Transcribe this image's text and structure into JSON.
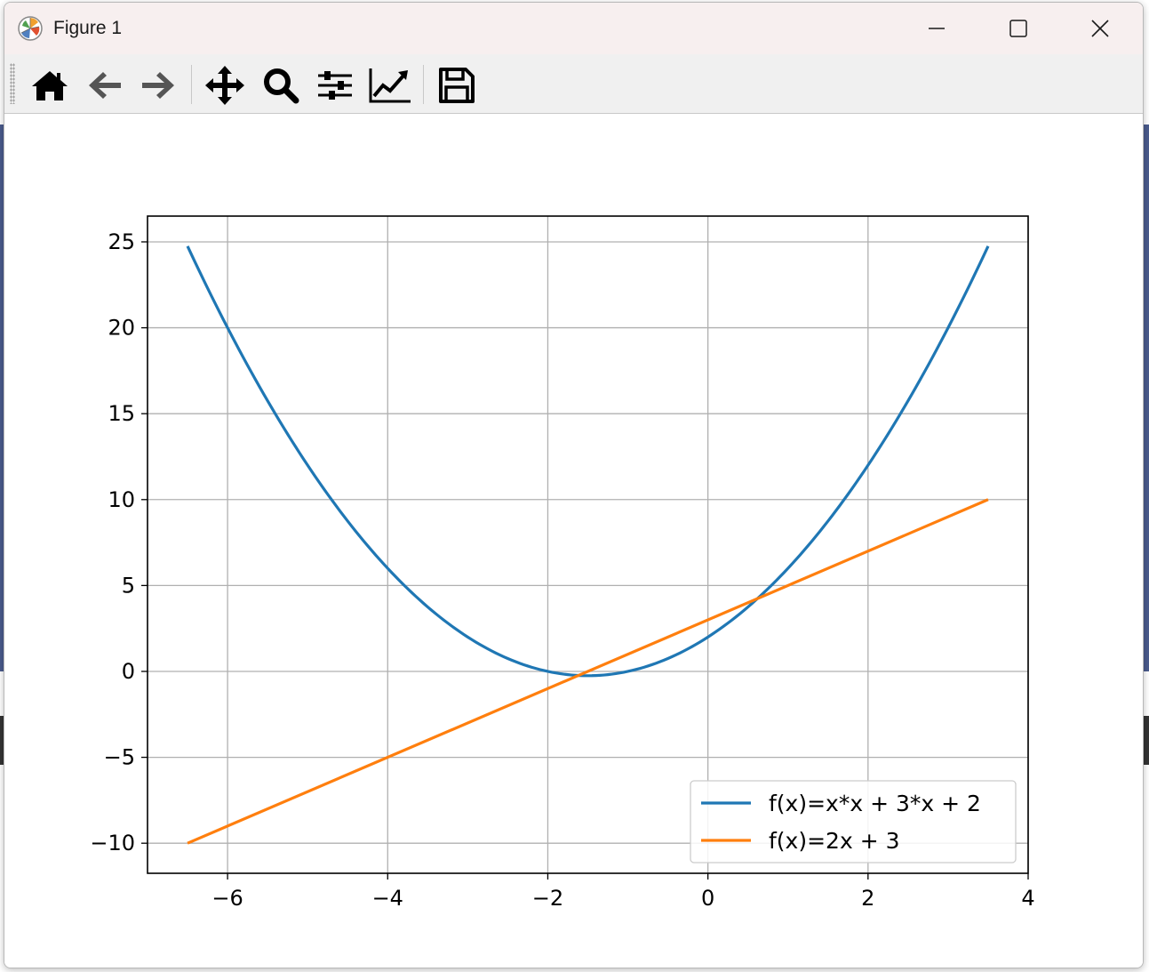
{
  "window": {
    "title": "Figure 1"
  },
  "toolbar": {
    "buttons": [
      {
        "name": "home-icon"
      },
      {
        "name": "back-arrow-icon"
      },
      {
        "name": "forward-arrow-icon"
      },
      {
        "name": "pan-icon"
      },
      {
        "name": "zoom-icon"
      },
      {
        "name": "configure-subplots-icon"
      },
      {
        "name": "edit-axis-icon"
      },
      {
        "name": "save-icon"
      }
    ]
  },
  "colors": {
    "series1": "#1f77b4",
    "series2": "#ff7f0e",
    "grid": "#b0b0b0",
    "titlebar": "#f7efef",
    "toolbar": "#f0f0f0"
  },
  "chart_data": {
    "type": "line",
    "title": "",
    "xlabel": "",
    "ylabel": "",
    "xlim": [
      -7,
      4
    ],
    "ylim": [
      -11.75,
      26.5
    ],
    "xticks": [
      -6,
      -4,
      -2,
      0,
      2,
      4
    ],
    "yticks": [
      -10,
      -5,
      0,
      5,
      10,
      15,
      20,
      25
    ],
    "xtick_labels": [
      "−6",
      "−4",
      "−2",
      "0",
      "2",
      "4"
    ],
    "ytick_labels": [
      "−10",
      "−5",
      "0",
      "5",
      "10",
      "15",
      "20",
      "25"
    ],
    "grid": true,
    "legend_position": "lower right",
    "series": [
      {
        "name": "f(x)=x*x + 3*x + 2",
        "x": [
          -6.5,
          -6.0,
          -5.5,
          -5.0,
          -4.5,
          -4.0,
          -3.5,
          -3.0,
          -2.5,
          -2.0,
          -1.5,
          -1.0,
          -0.5,
          0.0,
          0.5,
          1.0,
          1.5,
          2.0,
          2.5,
          3.0,
          3.5
        ],
        "y": [
          24.75,
          20.0,
          15.75,
          12.0,
          8.75,
          6.0,
          3.75,
          2.0,
          0.75,
          0.0,
          -0.25,
          0.0,
          0.75,
          2.0,
          3.75,
          6.0,
          8.75,
          12.0,
          15.75,
          20.0,
          24.75
        ]
      },
      {
        "name": "f(x)=2x + 3",
        "x": [
          -6.5,
          3.5
        ],
        "y": [
          -10.0,
          10.0
        ]
      }
    ]
  }
}
